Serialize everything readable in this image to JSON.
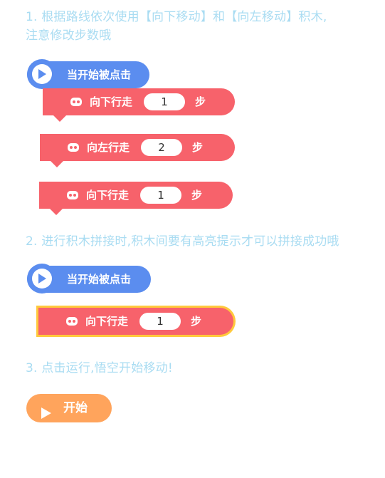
{
  "colors": {
    "hint_text": "#a9dcf2",
    "event_block": "#5b8def",
    "motion_block": "#f7626b",
    "highlight_outline": "#ffc93c",
    "start_button": "#ffa45c"
  },
  "section1": {
    "line1": "1. 根据路线依次使用【向下移动】和【向左移动】积木,",
    "line2": "注意修改步数哦",
    "hat_label": "当开始被点击",
    "blocks": [
      {
        "verb": "向下行走",
        "value": "1",
        "unit": "步"
      },
      {
        "verb": "向左行走",
        "value": "2",
        "unit": "步"
      },
      {
        "verb": "向下行走",
        "value": "1",
        "unit": "步"
      }
    ]
  },
  "section2": {
    "text": "2. 进行积木拼接时,积木间要有高亮提示才可以拼接成功哦",
    "hat_label": "当开始被点击",
    "block": {
      "verb": "向下行走",
      "value": "1",
      "unit": "步"
    }
  },
  "section3": {
    "text": "3. 点击运行,悟空开始移动!",
    "start_label": "开始"
  },
  "icons": {
    "play": "play-icon",
    "robot": "robot-icon"
  }
}
